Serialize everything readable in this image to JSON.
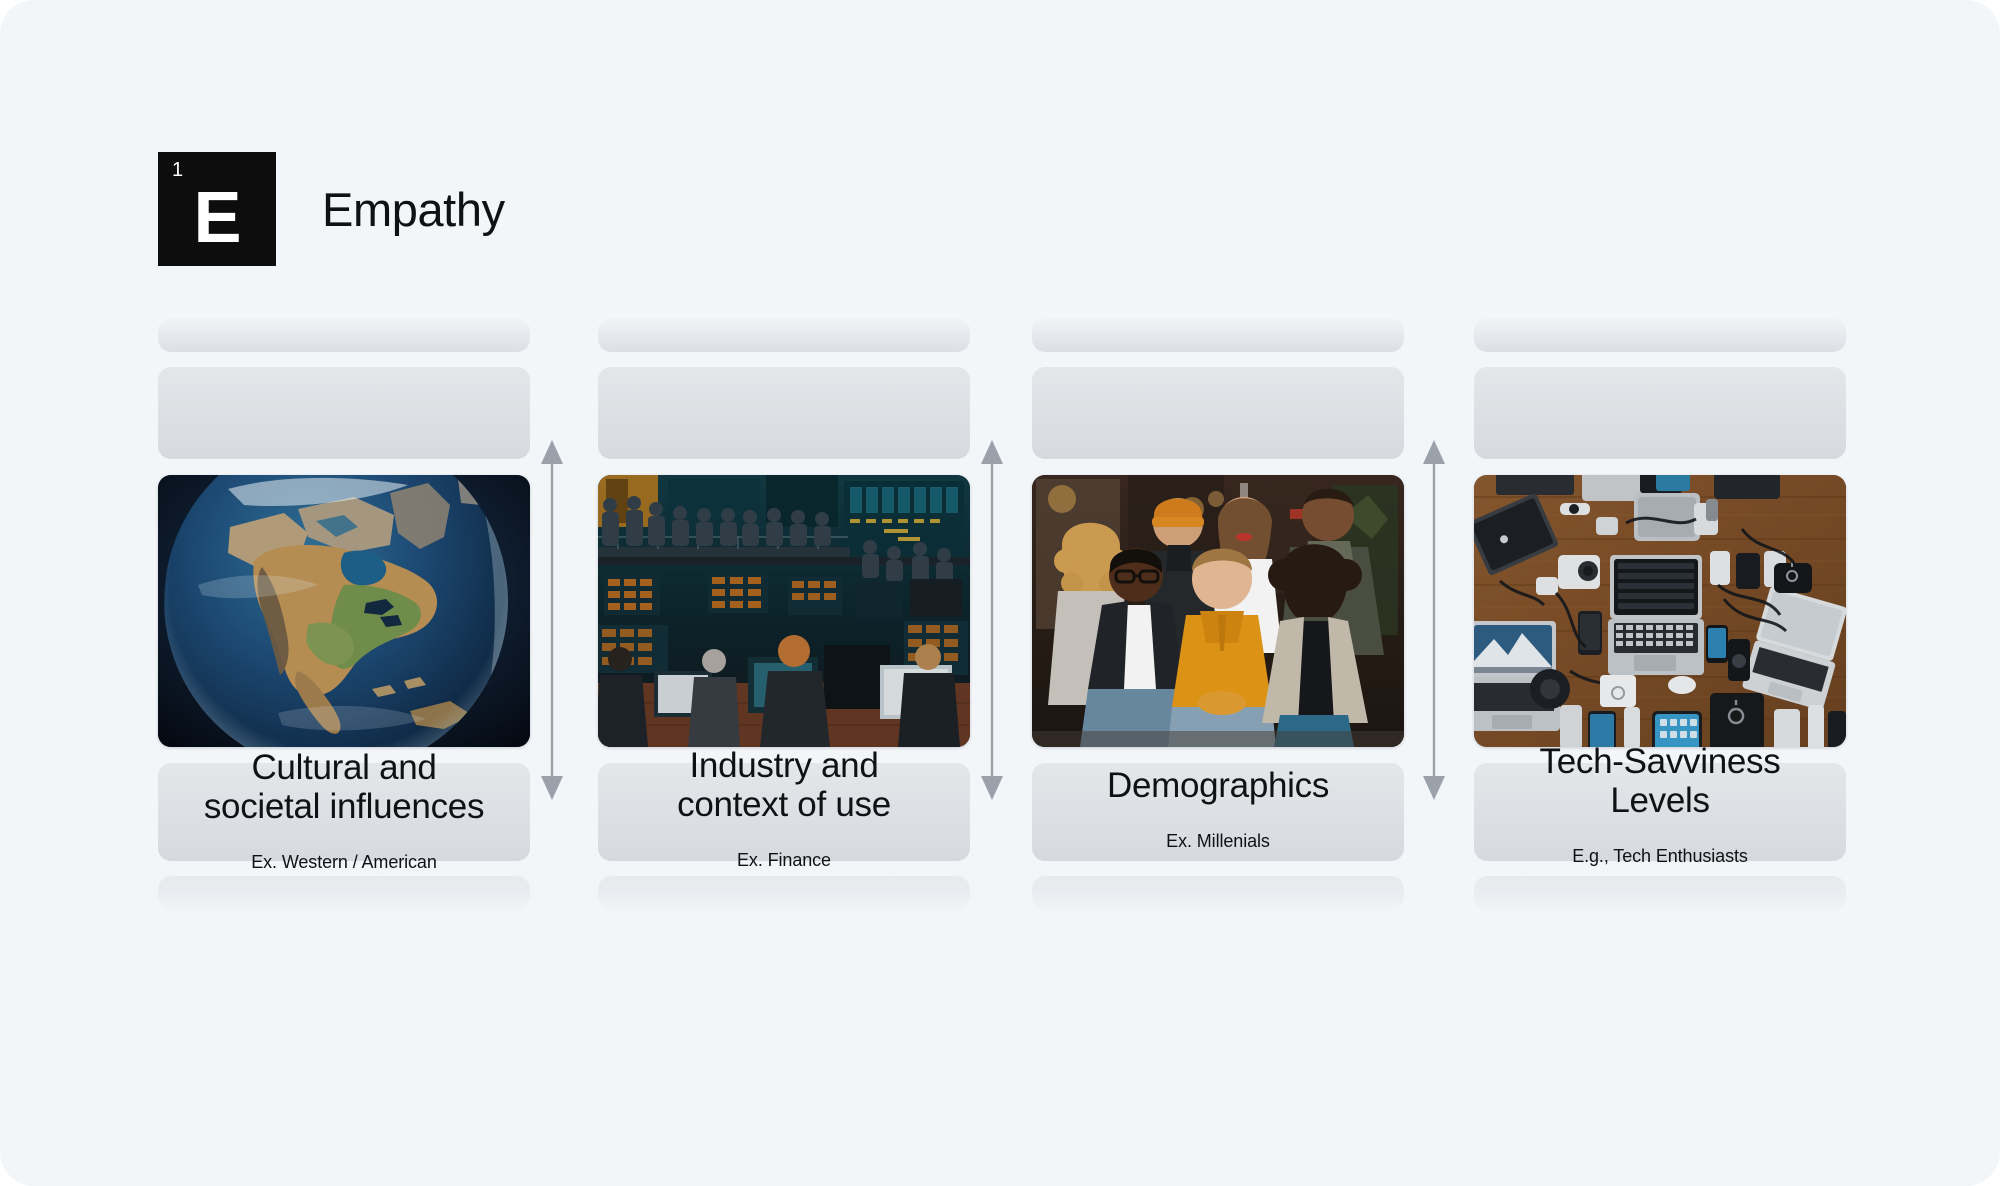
{
  "theme": {
    "page_background": "#ffffff",
    "card_background": "#f2f6f9",
    "badge_background": "#0d0d0d",
    "badge_text_color": "#ffffff",
    "text_color": "#101114",
    "skeleton_color": "#dcdfe3",
    "arrow_color": "#9aa1a8"
  },
  "header": {
    "badge_number": "1",
    "badge_letter": "E",
    "title": "Empathy"
  },
  "columns": [
    {
      "caption_line1": "Cultural and",
      "caption_line2": "societal influences",
      "subcaption": "Ex. Western / American",
      "image_name": "earth-globe-north-america-image"
    },
    {
      "caption_line1": "Industry and",
      "caption_line2": "context of use",
      "subcaption": "Ex. Finance",
      "image_name": "trading-floor-image"
    },
    {
      "caption_line1": "Demographics",
      "caption_line2": "",
      "subcaption": "Ex. Millenials",
      "image_name": "diverse-young-people-group-image"
    },
    {
      "caption_line1": "Tech-Savviness",
      "caption_line2": "Levels",
      "subcaption": "E.g., Tech Enthusiasts",
      "image_name": "laptops-gadgets-flatlay-image"
    }
  ],
  "arrows": [
    {
      "name": "vertical-double-arrow-1"
    },
    {
      "name": "vertical-double-arrow-2"
    },
    {
      "name": "vertical-double-arrow-3"
    }
  ]
}
